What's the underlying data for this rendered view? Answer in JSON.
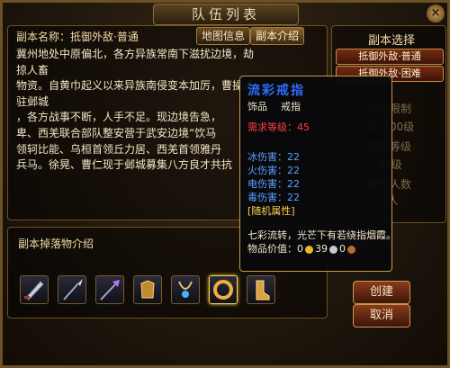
{
  "window": {
    "title": "队伍列表"
  },
  "header": {
    "dungeon_name_label": "副本名称：抵御外敌·普通"
  },
  "tabs": [
    {
      "label": "地图信息"
    },
    {
      "label": "副本介绍"
    }
  ],
  "description": {
    "lines": [
      "冀州地处中原偏北，各方异族常南下滋扰边境，劫掠人畜",
      "物资。自黄巾起义以来异族南侵变本加厉，曹操进驻邺城",
      "，各方战事不断，人手不足。现边境告急，",
      "卑、西羌联合部队整安营于武安边境“饮马",
      "领轲比能、乌桓首领丘力居、西羌首领雅丹",
      "兵马。徐晃、曹仁现于邺城募集八方良才共抗"
    ]
  },
  "drops": {
    "heading": "副本掉落物介绍",
    "items": [
      {
        "icon": "blade-icon"
      },
      {
        "icon": "spear-icon"
      },
      {
        "icon": "halberd-icon"
      },
      {
        "icon": "armor-icon"
      },
      {
        "icon": "necklace-icon"
      },
      {
        "icon": "ring-icon"
      },
      {
        "icon": "boots-icon"
      }
    ]
  },
  "dungeon_select": {
    "heading": "副本选择",
    "items": [
      {
        "label": "抵御外敌·普通"
      },
      {
        "label": "抵御外敌·困难"
      }
    ],
    "info_lines": [
      "等级限制",
      "40-100级",
      "推荐等级",
      "40级",
      "推荐人数",
      "5人"
    ]
  },
  "buttons": {
    "create": "创建",
    "cancel": "取消"
  },
  "tooltip": {
    "name": "流彩戒指",
    "category": "饰品",
    "subtype": "戒指",
    "requirement": "需求等级：45",
    "stats": [
      "冰伤害：22",
      "火伤害：22",
      "电伤害：22",
      "毒伤害：22"
    ],
    "random_attr": "[随机属性]",
    "flavor": "七彩流转，光芒下有若绕指烟霞。",
    "value_label": "物品价值：",
    "gold": "0",
    "silver": "39",
    "copper": "0"
  },
  "colors": {
    "name": "#2e6cff",
    "requirement": "#ff3c3c",
    "stats": "#5aa0ff",
    "random_attr": "#ffd24a",
    "body_text": "#f1e6c7"
  }
}
